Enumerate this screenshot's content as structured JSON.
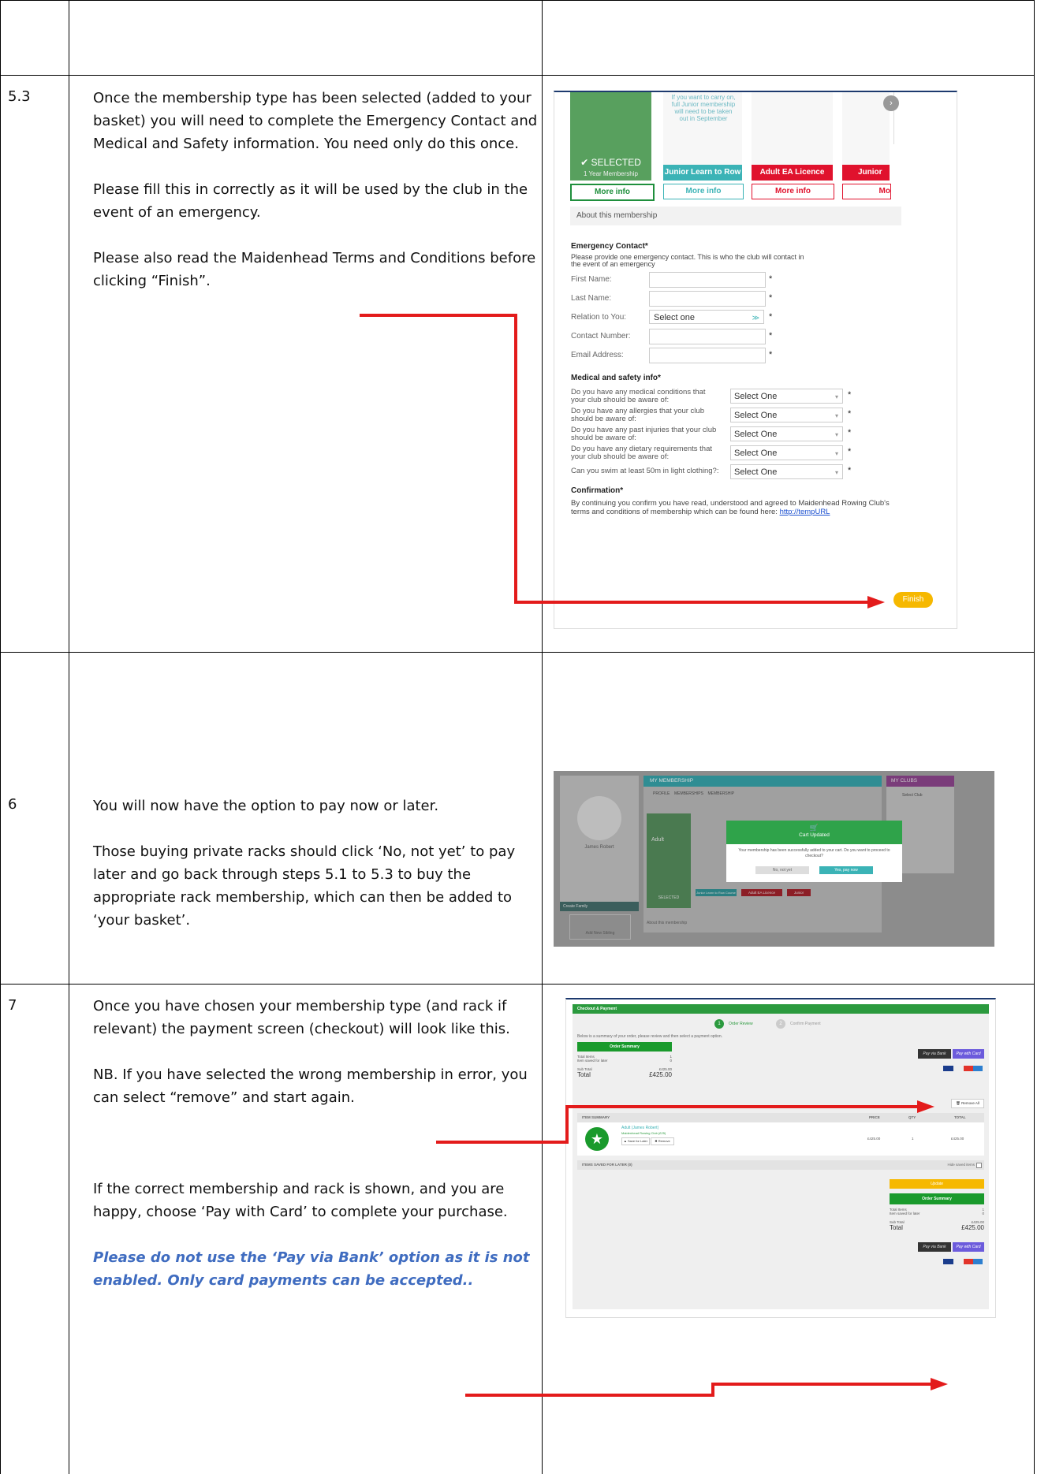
{
  "rows": [
    {
      "num": "5.3",
      "paragraphs": [
        "Once the membership type has been selected (added to your basket) you will need to complete the Emergency Contact and Medical and Safety information.  You need only do this once.",
        "Please fill this in correctly as it will be used by the club in the event of an emergency.",
        "Please also read the Maidenhead Terms and Conditions before clicking “Finish”."
      ]
    },
    {
      "num": "6",
      "paragraphs": [
        "You will now have the option to pay now or later.",
        "Those buying private racks should click ‘No, not yet’ to pay later and go back through steps 5.1 to 5.3 to buy the appropriate rack membership, which can then be added to ‘your basket’."
      ]
    },
    {
      "num": "7",
      "paragraphs": [
        "Once you have chosen your membership type (and rack if relevant) the payment screen (checkout) will look like this.",
        "NB. If you have selected the wrong membership in error, you can select “remove” and start again.",
        "If the correct membership and rack is shown, and you are happy, choose ‘Pay with Card’ to complete your purchase."
      ],
      "emphasis": "Please do not use the ‘Pay via Bank’ option as it is not enabled.  Only card payments can be accepted.."
    }
  ],
  "shot1": {
    "top_text": "If you want to carry on, full Junior membership will need to be taken out in September",
    "selected_label": "SELECTED",
    "selected_sub": "1 Year Membership",
    "more_info": "More info",
    "cards": [
      "Junior Learn to Row Course",
      "Adult EA Licence",
      "Junior"
    ],
    "card_partial_btn": "Mo",
    "about": "About this membership",
    "emergency_title": "Emergency Contact*",
    "emergency_desc": "Please provide one emergency contact. This is who the club will contact in the event of an emergency",
    "fields": [
      "First Name:",
      "Last Name:",
      "Relation to You:",
      "Contact Number:",
      "Email Address:"
    ],
    "relation_placeholder": "Select one",
    "medical_title": "Medical and safety info*",
    "medical_questions": [
      "Do you have any medical conditions that your club should be aware of:",
      "Do you have any allergies that your club should be aware of:",
      "Do you have any past injuries that your club should be aware of:",
      "Do you have any dietary requirements that your club should be aware of:",
      "Can you swim at least 50m in light clothing?:"
    ],
    "select_one": "Select One",
    "confirmation_title": "Confirmation*",
    "confirmation_text": "By continuing you confirm you have read, understood and agreed to Maidenhead Rowing Club's terms and conditions of membership which can be found here:",
    "confirmation_link": "http://tempURL",
    "finish": "Finish"
  },
  "shot2": {
    "my_membership": "MY MEMBERSHIP",
    "my_clubs": "MY CLUBS",
    "name": "James Robert",
    "tabs": [
      "PROFILE",
      "MEMBERSHIPS",
      "MEMBERSHIP"
    ],
    "create_family": "Create Family",
    "add_family": "Add New Sibling",
    "select_club": "Select Club",
    "adult": "Adult",
    "selected": "SELECTED",
    "about": "About this membership",
    "card_labels": [
      "Junior Learn to Row Course",
      "Adult EA Licence",
      "Junior"
    ],
    "modal_title": "Cart Updated",
    "modal_text": "Your membership has been successfully added to your cart. Do you want to proceed to checkout?",
    "btn_no": "No, not yet",
    "btn_yes": "Yes, pay now"
  },
  "shot3": {
    "header": "Checkout & Payment",
    "step1": "Order Review",
    "step2": "Confirm Payment",
    "intro": "Below is a summary of your order, please review and then select a payment option.",
    "summary_title": "Order Summary",
    "total_items_label": "Total Items",
    "total_items": "1",
    "saved_label": "Item saved for later",
    "saved": "0",
    "subtotal_label": "Sub Total",
    "subtotal": "£425.00",
    "total_label": "Total",
    "total": "£425.00",
    "pay_bank": "Pay via Bank",
    "pay_card": "Pay with Card",
    "remove_all": "Remove All",
    "col_item": "ITEM SUMMARY",
    "col_price": "PRICE",
    "col_qty": "QTY",
    "col_total": "TOTAL",
    "item_name": "Adult (James Robert)",
    "item_club": "Maidenhead Rowing Club (£25)",
    "save_later": "Save for Later",
    "remove": "Remove",
    "item_price": "£425.00",
    "item_qty": "1",
    "item_total": "£425.00",
    "saved_later_title": "ITEMS SAVED FOR LATER (0)",
    "hide_saved": "Hide saved items",
    "update": "Update"
  }
}
